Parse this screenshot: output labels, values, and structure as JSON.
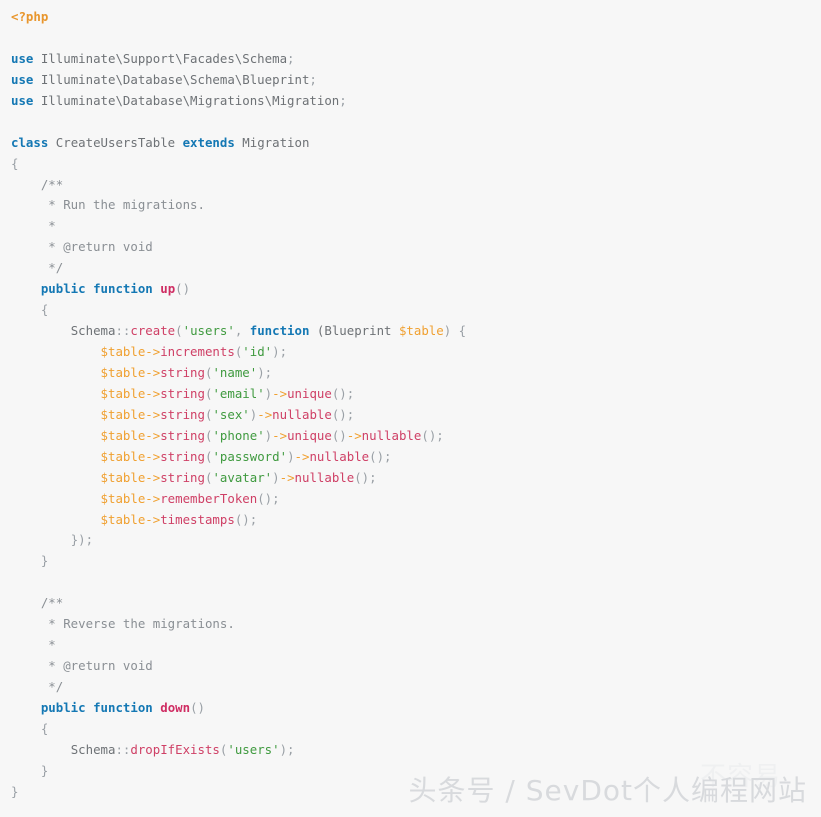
{
  "document": {
    "language": "php",
    "background_color": "#f7f7f7",
    "default_text_color": "#6e7276"
  },
  "theme": {
    "php_tag": "#e8962d",
    "keyword": "#1478b4",
    "function_name": "#cf2d63",
    "method_name": "#cf4066",
    "variable": "#f0a030",
    "string": "#3f9a3f",
    "comment": "#8a8f94",
    "punctuation": "#9aa0a6"
  },
  "code": {
    "lines": [
      {
        "id": "l1",
        "indent": 0,
        "tokens": [
          {
            "t": "<?php",
            "c": "php"
          }
        ]
      },
      {
        "id": "l2",
        "indent": 0,
        "tokens": []
      },
      {
        "id": "l3",
        "indent": 0,
        "tokens": [
          {
            "t": "use",
            "c": "keyword"
          },
          {
            "t": " Illuminate\\Support\\Facades\\Schema",
            "c": "plain"
          },
          {
            "t": ";",
            "c": "punct"
          }
        ]
      },
      {
        "id": "l4",
        "indent": 0,
        "tokens": [
          {
            "t": "use",
            "c": "keyword"
          },
          {
            "t": " Illuminate\\Database\\Schema\\Blueprint",
            "c": "plain"
          },
          {
            "t": ";",
            "c": "punct"
          }
        ]
      },
      {
        "id": "l5",
        "indent": 0,
        "tokens": [
          {
            "t": "use",
            "c": "keyword"
          },
          {
            "t": " Illuminate\\Database\\Migrations\\Migration",
            "c": "plain"
          },
          {
            "t": ";",
            "c": "punct"
          }
        ]
      },
      {
        "id": "l6",
        "indent": 0,
        "tokens": []
      },
      {
        "id": "l7",
        "indent": 0,
        "tokens": [
          {
            "t": "class",
            "c": "keyword"
          },
          {
            "t": " CreateUsersTable ",
            "c": "plain"
          },
          {
            "t": "extends",
            "c": "keyword"
          },
          {
            "t": " Migration",
            "c": "plain"
          }
        ]
      },
      {
        "id": "l8",
        "indent": 0,
        "tokens": [
          {
            "t": "{",
            "c": "punct"
          }
        ]
      },
      {
        "id": "l9",
        "indent": 1,
        "tokens": [
          {
            "t": "/**",
            "c": "comment"
          }
        ]
      },
      {
        "id": "l10",
        "indent": 1,
        "tokens": [
          {
            "t": " * Run the migrations.",
            "c": "comment"
          }
        ]
      },
      {
        "id": "l11",
        "indent": 1,
        "tokens": [
          {
            "t": " *",
            "c": "comment"
          }
        ]
      },
      {
        "id": "l12",
        "indent": 1,
        "tokens": [
          {
            "t": " * @return void",
            "c": "comment"
          }
        ]
      },
      {
        "id": "l13",
        "indent": 1,
        "tokens": [
          {
            "t": " */",
            "c": "comment"
          }
        ]
      },
      {
        "id": "l14",
        "indent": 1,
        "tokens": [
          {
            "t": "public",
            "c": "keyword"
          },
          {
            "t": " ",
            "c": "plain"
          },
          {
            "t": "function",
            "c": "keyword"
          },
          {
            "t": " ",
            "c": "plain"
          },
          {
            "t": "up",
            "c": "func"
          },
          {
            "t": "()",
            "c": "punct"
          }
        ]
      },
      {
        "id": "l15",
        "indent": 1,
        "tokens": [
          {
            "t": "{",
            "c": "punct"
          }
        ]
      },
      {
        "id": "l16",
        "indent": 2,
        "tokens": [
          {
            "t": "Schema",
            "c": "plain"
          },
          {
            "t": "::",
            "c": "punct"
          },
          {
            "t": "create",
            "c": "method"
          },
          {
            "t": "(",
            "c": "punct"
          },
          {
            "t": "'users'",
            "c": "string"
          },
          {
            "t": ", ",
            "c": "punct"
          },
          {
            "t": "function",
            "c": "keyword"
          },
          {
            "t": " (Blueprint ",
            "c": "plain"
          },
          {
            "t": "$table",
            "c": "var"
          },
          {
            "t": ") {",
            "c": "punct"
          }
        ]
      },
      {
        "id": "l17",
        "indent": 3,
        "tokens": [
          {
            "t": "$table",
            "c": "var"
          },
          {
            "t": "->",
            "c": "arrow"
          },
          {
            "t": "increments",
            "c": "method"
          },
          {
            "t": "(",
            "c": "punct"
          },
          {
            "t": "'id'",
            "c": "string"
          },
          {
            "t": ");",
            "c": "punct"
          }
        ]
      },
      {
        "id": "l18",
        "indent": 3,
        "tokens": [
          {
            "t": "$table",
            "c": "var"
          },
          {
            "t": "->",
            "c": "arrow"
          },
          {
            "t": "string",
            "c": "method"
          },
          {
            "t": "(",
            "c": "punct"
          },
          {
            "t": "'name'",
            "c": "string"
          },
          {
            "t": ");",
            "c": "punct"
          }
        ]
      },
      {
        "id": "l19",
        "indent": 3,
        "tokens": [
          {
            "t": "$table",
            "c": "var"
          },
          {
            "t": "->",
            "c": "arrow"
          },
          {
            "t": "string",
            "c": "method"
          },
          {
            "t": "(",
            "c": "punct"
          },
          {
            "t": "'email'",
            "c": "string"
          },
          {
            "t": ")",
            "c": "punct"
          },
          {
            "t": "->",
            "c": "arrow"
          },
          {
            "t": "unique",
            "c": "method"
          },
          {
            "t": "();",
            "c": "punct"
          }
        ]
      },
      {
        "id": "l20",
        "indent": 3,
        "tokens": [
          {
            "t": "$table",
            "c": "var"
          },
          {
            "t": "->",
            "c": "arrow"
          },
          {
            "t": "string",
            "c": "method"
          },
          {
            "t": "(",
            "c": "punct"
          },
          {
            "t": "'sex'",
            "c": "string"
          },
          {
            "t": ")",
            "c": "punct"
          },
          {
            "t": "->",
            "c": "arrow"
          },
          {
            "t": "nullable",
            "c": "method"
          },
          {
            "t": "();",
            "c": "punct"
          }
        ]
      },
      {
        "id": "l21",
        "indent": 3,
        "tokens": [
          {
            "t": "$table",
            "c": "var"
          },
          {
            "t": "->",
            "c": "arrow"
          },
          {
            "t": "string",
            "c": "method"
          },
          {
            "t": "(",
            "c": "punct"
          },
          {
            "t": "'phone'",
            "c": "string"
          },
          {
            "t": ")",
            "c": "punct"
          },
          {
            "t": "->",
            "c": "arrow"
          },
          {
            "t": "unique",
            "c": "method"
          },
          {
            "t": "()",
            "c": "punct"
          },
          {
            "t": "->",
            "c": "arrow"
          },
          {
            "t": "nullable",
            "c": "method"
          },
          {
            "t": "();",
            "c": "punct"
          }
        ]
      },
      {
        "id": "l22",
        "indent": 3,
        "tokens": [
          {
            "t": "$table",
            "c": "var"
          },
          {
            "t": "->",
            "c": "arrow"
          },
          {
            "t": "string",
            "c": "method"
          },
          {
            "t": "(",
            "c": "punct"
          },
          {
            "t": "'password'",
            "c": "string"
          },
          {
            "t": ")",
            "c": "punct"
          },
          {
            "t": "->",
            "c": "arrow"
          },
          {
            "t": "nullable",
            "c": "method"
          },
          {
            "t": "();",
            "c": "punct"
          }
        ]
      },
      {
        "id": "l23",
        "indent": 3,
        "tokens": [
          {
            "t": "$table",
            "c": "var"
          },
          {
            "t": "->",
            "c": "arrow"
          },
          {
            "t": "string",
            "c": "method"
          },
          {
            "t": "(",
            "c": "punct"
          },
          {
            "t": "'avatar'",
            "c": "string"
          },
          {
            "t": ")",
            "c": "punct"
          },
          {
            "t": "->",
            "c": "arrow"
          },
          {
            "t": "nullable",
            "c": "method"
          },
          {
            "t": "();",
            "c": "punct"
          }
        ]
      },
      {
        "id": "l24",
        "indent": 3,
        "tokens": [
          {
            "t": "$table",
            "c": "var"
          },
          {
            "t": "->",
            "c": "arrow"
          },
          {
            "t": "rememberToken",
            "c": "method"
          },
          {
            "t": "();",
            "c": "punct"
          }
        ]
      },
      {
        "id": "l25",
        "indent": 3,
        "tokens": [
          {
            "t": "$table",
            "c": "var"
          },
          {
            "t": "->",
            "c": "arrow"
          },
          {
            "t": "timestamps",
            "c": "method"
          },
          {
            "t": "();",
            "c": "punct"
          }
        ]
      },
      {
        "id": "l26",
        "indent": 2,
        "tokens": [
          {
            "t": "});",
            "c": "punct"
          }
        ]
      },
      {
        "id": "l27",
        "indent": 1,
        "tokens": [
          {
            "t": "}",
            "c": "punct"
          }
        ]
      },
      {
        "id": "l28",
        "indent": 0,
        "tokens": []
      },
      {
        "id": "l29",
        "indent": 1,
        "tokens": [
          {
            "t": "/**",
            "c": "comment"
          }
        ]
      },
      {
        "id": "l30",
        "indent": 1,
        "tokens": [
          {
            "t": " * Reverse the migrations.",
            "c": "comment"
          }
        ]
      },
      {
        "id": "l31",
        "indent": 1,
        "tokens": [
          {
            "t": " *",
            "c": "comment"
          }
        ]
      },
      {
        "id": "l32",
        "indent": 1,
        "tokens": [
          {
            "t": " * @return void",
            "c": "comment"
          }
        ]
      },
      {
        "id": "l33",
        "indent": 1,
        "tokens": [
          {
            "t": " */",
            "c": "comment"
          }
        ]
      },
      {
        "id": "l34",
        "indent": 1,
        "tokens": [
          {
            "t": "public",
            "c": "keyword"
          },
          {
            "t": " ",
            "c": "plain"
          },
          {
            "t": "function",
            "c": "keyword"
          },
          {
            "t": " ",
            "c": "plain"
          },
          {
            "t": "down",
            "c": "func"
          },
          {
            "t": "()",
            "c": "punct"
          }
        ]
      },
      {
        "id": "l35",
        "indent": 1,
        "tokens": [
          {
            "t": "{",
            "c": "punct"
          }
        ]
      },
      {
        "id": "l36",
        "indent": 2,
        "tokens": [
          {
            "t": "Schema",
            "c": "plain"
          },
          {
            "t": "::",
            "c": "punct"
          },
          {
            "t": "dropIfExists",
            "c": "method"
          },
          {
            "t": "(",
            "c": "punct"
          },
          {
            "t": "'users'",
            "c": "string"
          },
          {
            "t": ");",
            "c": "punct"
          }
        ]
      },
      {
        "id": "l37",
        "indent": 1,
        "tokens": [
          {
            "t": "}",
            "c": "punct"
          }
        ]
      },
      {
        "id": "l38",
        "indent": 0,
        "tokens": [
          {
            "t": "}",
            "c": "punct"
          }
        ]
      }
    ]
  },
  "watermark": {
    "text": "头条号 / SevDot个人编程网站",
    "ghost_text": "不容易",
    "color": "#d8dadd"
  }
}
